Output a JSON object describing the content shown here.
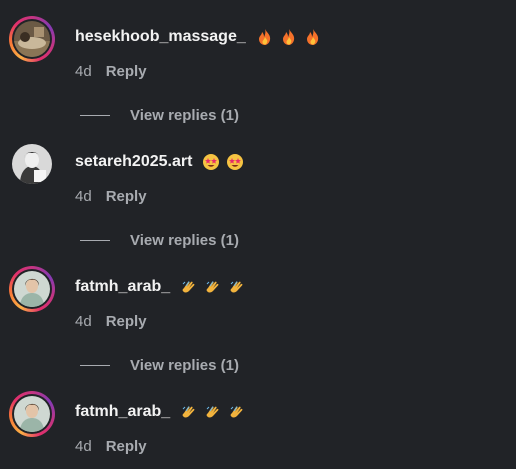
{
  "comments": [
    {
      "username": "hesekhoob_massage_",
      "emojis": [
        "fire-emoji",
        "fire-emoji",
        "fire-emoji"
      ],
      "time": "4d",
      "reply_label": "Reply",
      "view_replies": "View replies (1)",
      "avatar": "massage-photo-avatar"
    },
    {
      "username": "setareh2025.art",
      "emojis": [
        "star-struck-emoji",
        "star-struck-emoji"
      ],
      "time": "4d",
      "reply_label": "Reply",
      "view_replies": "View replies (1)",
      "avatar": "sketch-portrait-avatar"
    },
    {
      "username": "fatmh_arab_",
      "emojis": [
        "clapping-hands-emoji",
        "clapping-hands-emoji",
        "clapping-hands-emoji"
      ],
      "time": "4d",
      "reply_label": "Reply",
      "view_replies": "View replies (1)",
      "avatar": "woman-portrait-avatar"
    },
    {
      "username": "fatmh_arab_",
      "emojis": [
        "clapping-hands-emoji",
        "clapping-hands-emoji",
        "clapping-hands-emoji"
      ],
      "time": "4d",
      "reply_label": "Reply",
      "avatar": "woman-portrait-avatar"
    }
  ],
  "colors": {
    "background": "#212327",
    "text_primary": "#f2f2f2",
    "text_secondary": "#a8abb0",
    "fire": "#f5712a",
    "star_face": "#f6c342",
    "star": "#e8296b",
    "clap": "#f2b33d"
  }
}
